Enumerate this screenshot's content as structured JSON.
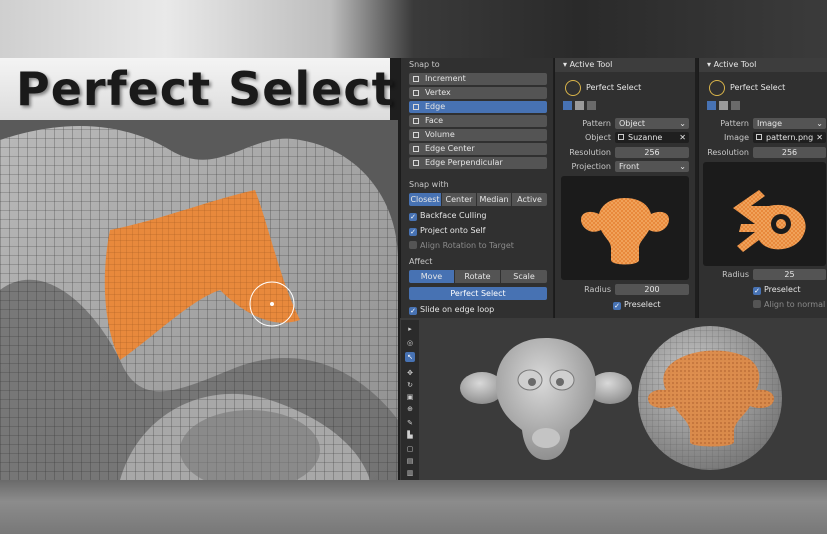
{
  "title": "Perfect Select",
  "snap_panel": {
    "snap_to_label": "Snap to",
    "snap_options": [
      {
        "label": "Increment",
        "selected": false
      },
      {
        "label": "Vertex",
        "selected": false
      },
      {
        "label": "Edge",
        "selected": true
      },
      {
        "label": "Face",
        "selected": false
      },
      {
        "label": "Volume",
        "selected": false
      },
      {
        "label": "Edge Center",
        "selected": false
      },
      {
        "label": "Edge Perpendicular",
        "selected": false
      }
    ],
    "snap_with_label": "Snap with",
    "snap_with": [
      {
        "label": "Closest",
        "selected": true
      },
      {
        "label": "Center",
        "selected": false
      },
      {
        "label": "Median",
        "selected": false
      },
      {
        "label": "Active",
        "selected": false
      }
    ],
    "checks": [
      {
        "label": "Backface Culling",
        "checked": true
      },
      {
        "label": "Project onto Self",
        "checked": true
      },
      {
        "label": "Align Rotation to Target",
        "checked": false
      }
    ],
    "affect_label": "Affect",
    "affect": [
      {
        "label": "Move",
        "selected": true
      },
      {
        "label": "Rotate",
        "selected": false
      },
      {
        "label": "Scale",
        "selected": false
      }
    ],
    "perfect_select_button": "Perfect Select",
    "slide_on_edge_loop": {
      "label": "Slide on edge loop",
      "checked": true
    }
  },
  "tool_panel_1": {
    "header": "Active Tool",
    "tool_name": "Perfect Select",
    "pattern_label": "Pattern",
    "pattern_value": "Object",
    "object_label": "Object",
    "object_value": "Suzanne",
    "resolution_label": "Resolution",
    "resolution_value": "256",
    "projection_label": "Projection",
    "projection_value": "Front",
    "radius_label": "Radius",
    "radius_value": "200",
    "preselect_label": "Preselect",
    "preselect_checked": true
  },
  "tool_panel_2": {
    "header": "Active Tool",
    "tool_name": "Perfect Select",
    "pattern_label": "Pattern",
    "pattern_value": "Image",
    "image_label": "Image",
    "image_value": "pattern.png",
    "resolution_label": "Resolution",
    "resolution_value": "256",
    "radius_label": "Radius",
    "radius_value": "25",
    "preselect_label": "Preselect",
    "preselect_checked": true,
    "align_normal_label": "Align to normal",
    "align_normal_checked": false
  },
  "viewport_tools": [
    "cursor-icon",
    "select-icon",
    "move-icon",
    "rotate-icon",
    "scale-icon",
    "transform-icon",
    "annotate-icon",
    "measure-icon",
    "add-cube-icon",
    "extrude-icon",
    "inset-icon"
  ],
  "colors": {
    "accent": "#4772b3",
    "selection": "#e8893c",
    "panel": "#303030",
    "field": "#545454"
  }
}
